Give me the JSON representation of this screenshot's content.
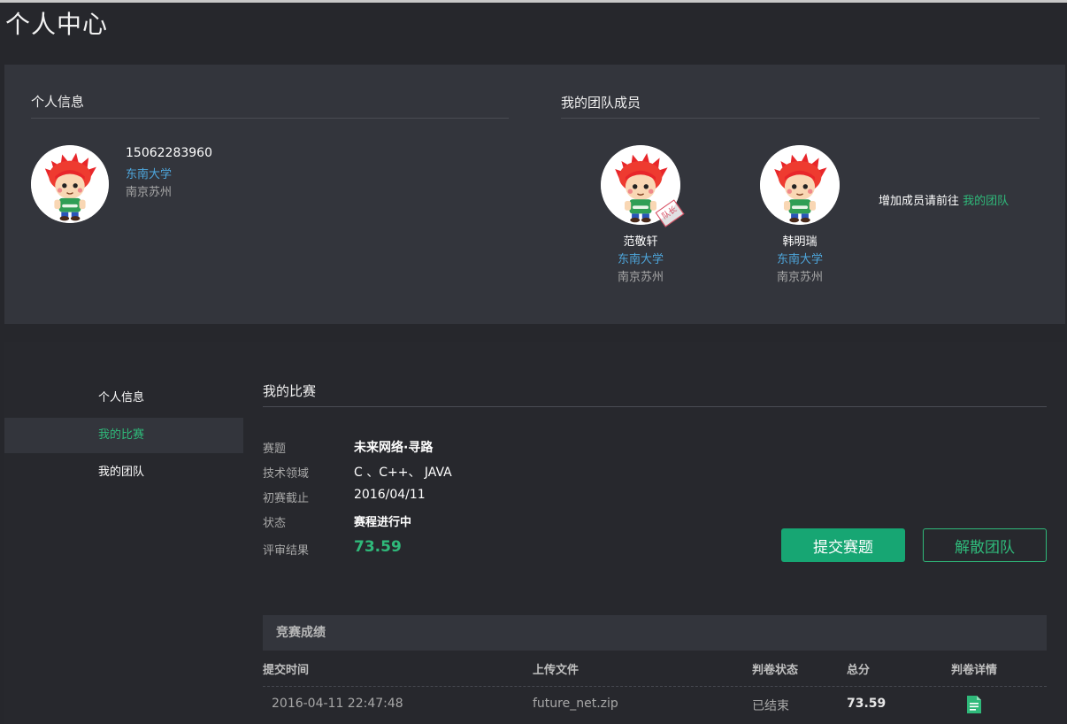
{
  "page": {
    "title": "个人中心"
  },
  "profile": {
    "title": "个人信息",
    "phone": "15062283960",
    "school": "东南大学",
    "city": "南京苏州"
  },
  "team": {
    "title": "我的团队成员",
    "leader_stamp": "队长",
    "members": [
      {
        "name": "范敬轩",
        "school": "东南大学",
        "city": "南京苏州"
      },
      {
        "name": "韩明瑞",
        "school": "东南大学",
        "city": "南京苏州"
      }
    ],
    "add_text": "增加成员请前往",
    "add_link": "我的团队"
  },
  "sidebar": {
    "items": [
      {
        "label": "个人信息"
      },
      {
        "label": "我的比赛"
      },
      {
        "label": "我的团队"
      }
    ]
  },
  "contest": {
    "title": "我的比赛",
    "fields": [
      {
        "label": "赛题",
        "value": "未来网络·寻路"
      },
      {
        "label": "技术领域",
        "value": "C 、C++、 JAVA"
      },
      {
        "label": "初赛截止",
        "value": "2016/04/11"
      },
      {
        "label": "状态",
        "value": "赛程进行中"
      },
      {
        "label": "评审结果",
        "value": "73.59"
      }
    ],
    "submit_label": "提交赛题",
    "dissolve_label": "解散团队"
  },
  "results": {
    "title": "竞赛成绩",
    "columns": [
      "提交时间",
      "上传文件",
      "判卷状态",
      "总分",
      "判卷详情"
    ],
    "rows": [
      {
        "time": "2016-04-11 22:47:48",
        "file": "future_net.zip",
        "status": "已结束",
        "score": "73.59"
      }
    ]
  },
  "colors": {
    "accent_green": "#2fb97a",
    "link_blue": "#4ea6dc",
    "button_green": "#17a673",
    "panel_bg": "#33353c",
    "page_bg": "#26272c"
  },
  "icons": {
    "avatar": "cartoon-red-hair-avatar",
    "detail": "document-icon"
  }
}
